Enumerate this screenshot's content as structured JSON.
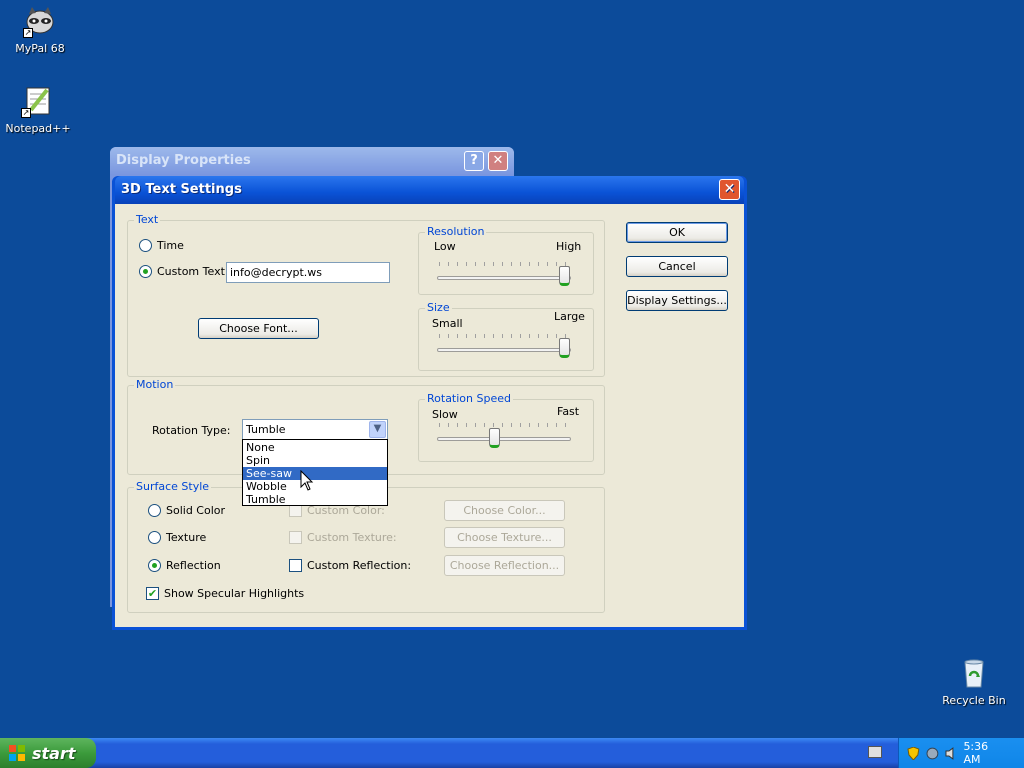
{
  "desktop": {
    "icons": [
      {
        "label": "MyPal 68"
      },
      {
        "label": "Notepad++"
      },
      {
        "label": "Recycle Bin"
      }
    ]
  },
  "parent_window": {
    "title": "Display Properties",
    "help_label": "?",
    "close_label": "✕"
  },
  "dialog": {
    "title": "3D Text Settings",
    "close_label": "✕",
    "text_group": {
      "label": "Text",
      "time_label": "Time",
      "custom_text_label": "Custom Text:",
      "custom_text_value": "info@decrypt.ws",
      "choose_font_label": "Choose Font..."
    },
    "resolution": {
      "label": "Resolution",
      "low": "Low",
      "high": "High",
      "level": 1.0
    },
    "size": {
      "label": "Size",
      "small": "Small",
      "large": "Large",
      "level": 1.0
    },
    "motion": {
      "label": "Motion",
      "rotation_type_label": "Rotation Type:",
      "rotation_type_value": "Tumble",
      "options": [
        "None",
        "Spin",
        "See-saw",
        "Wobble",
        "Tumble"
      ],
      "highlighted_option": "See-saw"
    },
    "rotation_speed": {
      "label": "Rotation Speed",
      "slow": "Slow",
      "fast": "Fast",
      "level": 0.43
    },
    "surface": {
      "label": "Surface Style",
      "solid_color_label": "Solid Color",
      "texture_label": "Texture",
      "reflection_label": "Reflection",
      "custom_color_label": "Custom Color:",
      "custom_texture_label": "Custom Texture:",
      "custom_reflection_label": "Custom Reflection:",
      "choose_color_label": "Choose Color...",
      "choose_texture_label": "Choose Texture...",
      "choose_reflection_label": "Choose Reflection...",
      "specular_label": "Show Specular Highlights"
    },
    "buttons": {
      "ok": "OK",
      "cancel": "Cancel",
      "display_settings": "Display Settings..."
    }
  },
  "taskbar": {
    "start_label": "start",
    "clock": "5:36 AM"
  }
}
